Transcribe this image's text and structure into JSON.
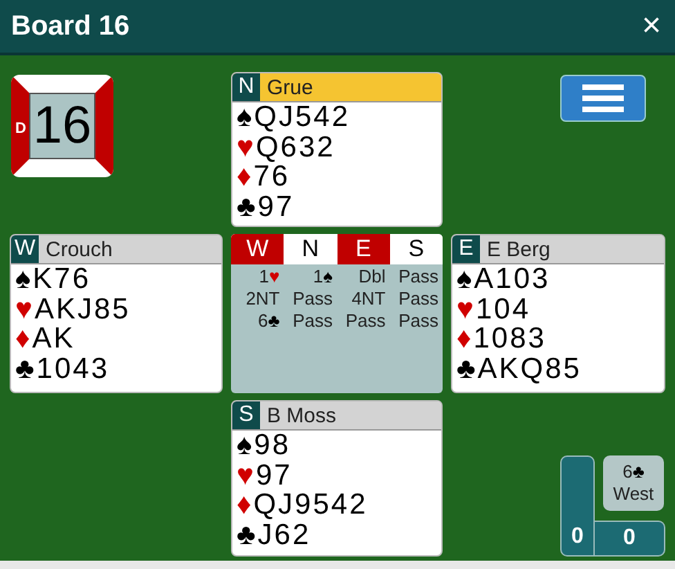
{
  "window": {
    "title": "Board 16",
    "close": "×"
  },
  "board": {
    "number": "16",
    "dealer_label": "D",
    "vulnerable": {
      "ns": false,
      "ew": true
    }
  },
  "hands": {
    "north": {
      "seat": "N",
      "player": "Grue",
      "highlighted": true,
      "suits": [
        {
          "kind": "spades",
          "symbol": "♠",
          "cards": "QJ542"
        },
        {
          "kind": "hearts",
          "symbol": "♥",
          "cards": "Q632"
        },
        {
          "kind": "diamonds",
          "symbol": "♦",
          "cards": "76"
        },
        {
          "kind": "clubs",
          "symbol": "♣",
          "cards": "97"
        }
      ]
    },
    "west": {
      "seat": "W",
      "player": "Crouch",
      "highlighted": false,
      "suits": [
        {
          "kind": "spades",
          "symbol": "♠",
          "cards": "K76"
        },
        {
          "kind": "hearts",
          "symbol": "♥",
          "cards": "AKJ85"
        },
        {
          "kind": "diamonds",
          "symbol": "♦",
          "cards": "AK"
        },
        {
          "kind": "clubs",
          "symbol": "♣",
          "cards": "1043"
        }
      ]
    },
    "east": {
      "seat": "E",
      "player": "E Berg",
      "highlighted": false,
      "suits": [
        {
          "kind": "spades",
          "symbol": "♠",
          "cards": "A103"
        },
        {
          "kind": "hearts",
          "symbol": "♥",
          "cards": "104"
        },
        {
          "kind": "diamonds",
          "symbol": "♦",
          "cards": "1083"
        },
        {
          "kind": "clubs",
          "symbol": "♣",
          "cards": "AKQ85"
        }
      ]
    },
    "south": {
      "seat": "S",
      "player": "B Moss",
      "highlighted": false,
      "suits": [
        {
          "kind": "spades",
          "symbol": "♠",
          "cards": "98"
        },
        {
          "kind": "hearts",
          "symbol": "♥",
          "cards": "97"
        },
        {
          "kind": "diamonds",
          "symbol": "♦",
          "cards": "QJ9542"
        },
        {
          "kind": "clubs",
          "symbol": "♣",
          "cards": "J62"
        }
      ]
    }
  },
  "auction": {
    "columns": [
      {
        "label": "W",
        "vulnerable": true
      },
      {
        "label": "N",
        "vulnerable": false
      },
      {
        "label": "E",
        "vulnerable": true
      },
      {
        "label": "S",
        "vulnerable": false
      }
    ],
    "bids": [
      {
        "text": "1",
        "suit": "♥",
        "kind": "hearts"
      },
      {
        "text": "1",
        "suit": "♠",
        "kind": "spades"
      },
      {
        "text": "Dbl"
      },
      {
        "text": "Pass"
      },
      {
        "text": "2NT"
      },
      {
        "text": "Pass"
      },
      {
        "text": "4NT"
      },
      {
        "text": "Pass"
      },
      {
        "text": "6",
        "suit": "♣",
        "kind": "clubs"
      },
      {
        "text": "Pass"
      },
      {
        "text": "Pass"
      },
      {
        "text": "Pass"
      }
    ]
  },
  "score": {
    "contract": {
      "text": "6",
      "suit": "♣",
      "kind": "clubs"
    },
    "declarer": "West",
    "ns_tricks": "0",
    "ew_tricks": "0"
  }
}
